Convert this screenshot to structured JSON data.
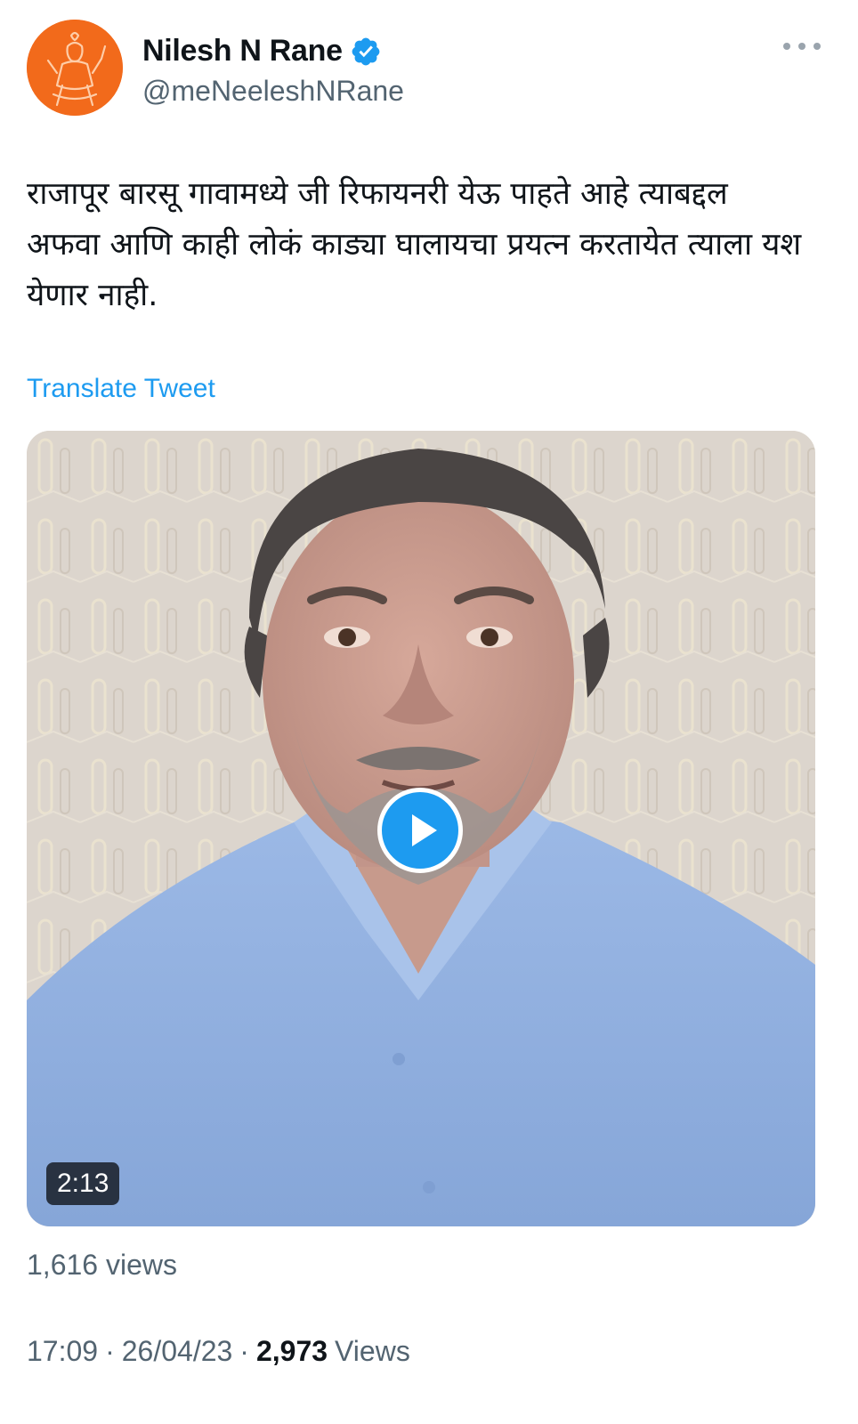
{
  "author": {
    "display_name": "Nilesh N Rane",
    "handle": "@meNeeleshNRane",
    "verified": true,
    "avatar_icon": "deity-silhouette-avatar",
    "avatar_color": "#f26a1b"
  },
  "tweet": {
    "text": "राजापूर बारसू गावामध्ये जी रिफायनरी येऊ पाहते आहे त्याबद्दल अफवा आणि काही लोकं काड्या घालायचा प्रयत्न करतायेत त्याला यश येणार नाही.",
    "translate_label": "Translate Tweet"
  },
  "media": {
    "type": "video",
    "duration": "2:13",
    "play_icon": "play-icon"
  },
  "stats": {
    "video_views": "1,616 views",
    "time": "17:09",
    "separator": "·",
    "date": "26/04/23",
    "views_number": "2,973",
    "views_label": "Views"
  },
  "colors": {
    "accent": "#1d9bf0",
    "text_primary": "#0f1419",
    "text_secondary": "#536471"
  }
}
